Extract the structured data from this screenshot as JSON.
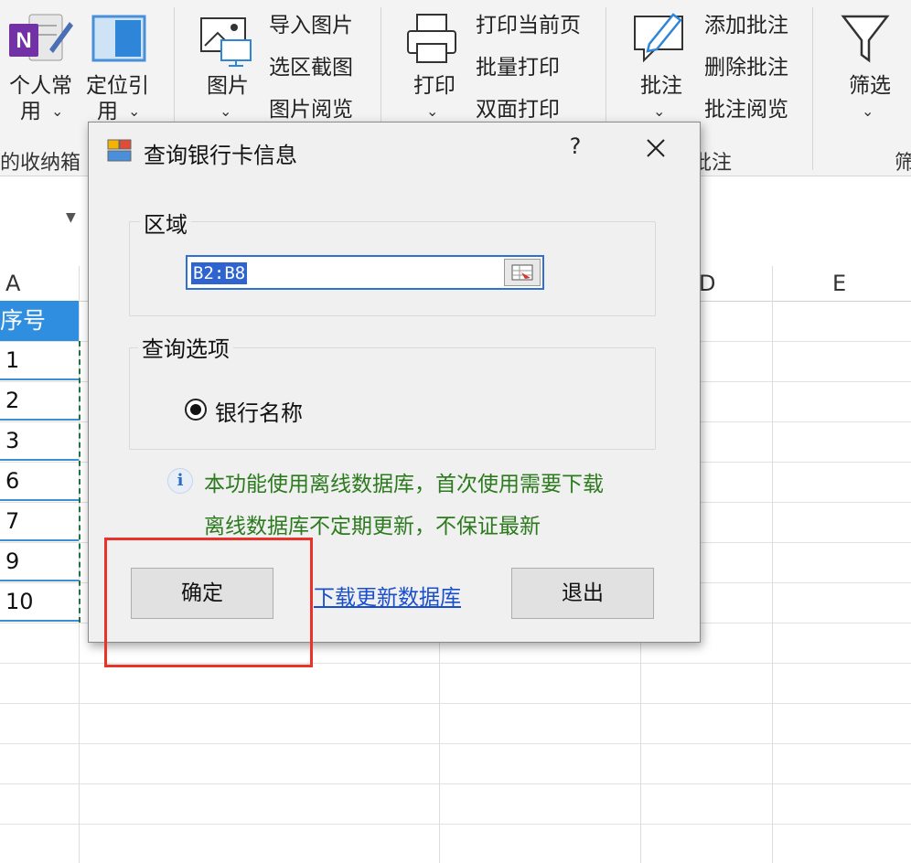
{
  "ribbon": {
    "personal": {
      "line1": "个人常",
      "line2": "用"
    },
    "locate": {
      "line1": "定位引",
      "line2": "用"
    },
    "picture": {
      "label": "图片",
      "items": [
        "导入图片",
        "选区截图",
        "图片阅览"
      ]
    },
    "print": {
      "label": "打印",
      "items": [
        "打印当前页",
        "批量打印",
        "双面打印"
      ]
    },
    "annotate": {
      "label": "批注",
      "items": [
        "添加批注",
        "删除批注",
        "批注阅览"
      ]
    },
    "filter": {
      "label": "筛选"
    },
    "group_labels": {
      "left": "的收纳箱",
      "annotate": "批注",
      "right": "筛"
    }
  },
  "sheet": {
    "columns": [
      "A",
      "D",
      "E"
    ],
    "header_cell": "序号",
    "rows": [
      "1",
      "2",
      "3",
      "6",
      "7",
      "9",
      "10"
    ]
  },
  "dialog": {
    "title": "查询银行卡信息",
    "help": "?",
    "region_title": "区域",
    "range_value": "B2:B8",
    "options_title": "查询选项",
    "option_label": "银行名称",
    "info_line1": "本功能使用离线数据库，首次使用需要下载",
    "info_line2": "离线数据库不定期更新，不保证最新",
    "ok_label": "确定",
    "download_link": "下载更新数据库",
    "exit_label": "退出"
  },
  "colors": {
    "accent": "#2f8ee0",
    "highlight": "#e8322a",
    "info_text": "#2b7a1d",
    "link": "#1a4fcc"
  }
}
